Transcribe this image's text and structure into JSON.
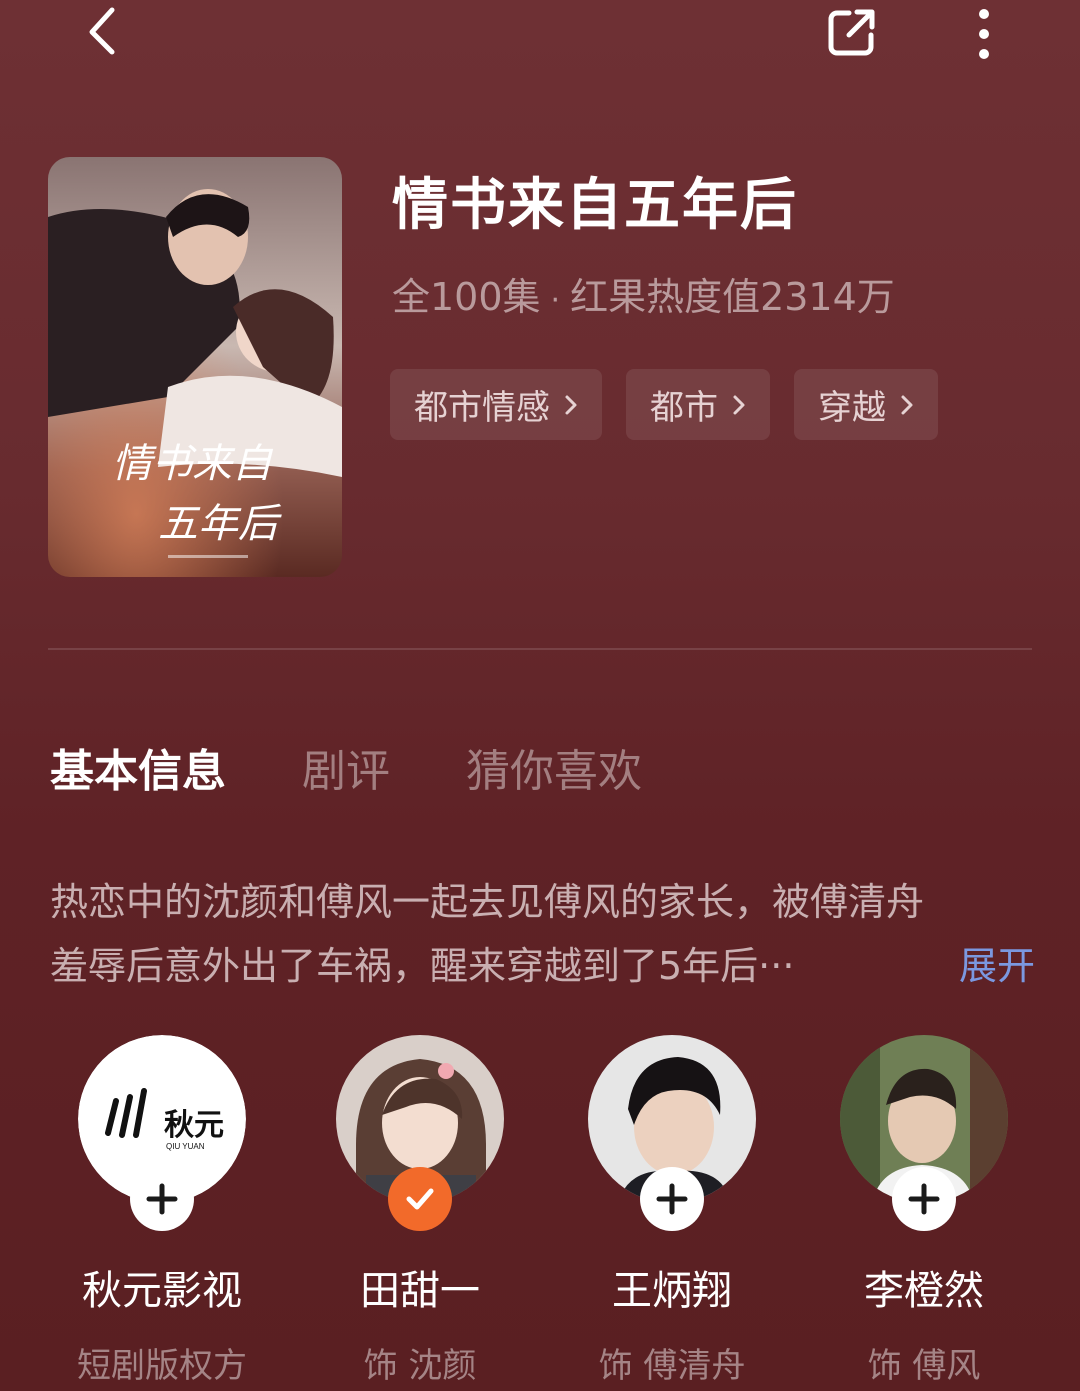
{
  "header": {
    "back_icon": "back-arrow-icon",
    "share_icon": "share-icon",
    "more_icon": "more-vertical-icon"
  },
  "show": {
    "title": "情书来自五年后",
    "episodes": "全100集",
    "separator": "·",
    "heat": "红果热度值2314万",
    "poster_title_line1": "情书来自",
    "poster_title_line2": "五年后",
    "tags": [
      "都市情感",
      "都市",
      "穿越"
    ]
  },
  "tabs": [
    {
      "label": "基本信息",
      "active": true
    },
    {
      "label": "剧评",
      "active": false
    },
    {
      "label": "猜你喜欢",
      "active": false
    }
  ],
  "synopsis": {
    "line1": "热恋中的沈颜和傅风一起去见傅风的家长，被傅清舟",
    "line2": "羞辱后意外出了车祸，醒来穿越到了5年后···",
    "expand_label": "展开"
  },
  "cast": [
    {
      "name": "秋元影视",
      "role": "短剧版权方",
      "followed": false,
      "logo_text": "秋元",
      "logo_sub": "QIU YUAN"
    },
    {
      "name": "田甜一",
      "role": "饰 沈颜",
      "followed": true
    },
    {
      "name": "王炳翔",
      "role": "饰 傅清舟",
      "followed": false
    },
    {
      "name": "李橙然",
      "role": "饰 傅风",
      "followed": false
    }
  ],
  "colors": {
    "background": "#6a2c30",
    "accent_orange": "#f26a2a",
    "expand_blue": "#7b98e0"
  }
}
